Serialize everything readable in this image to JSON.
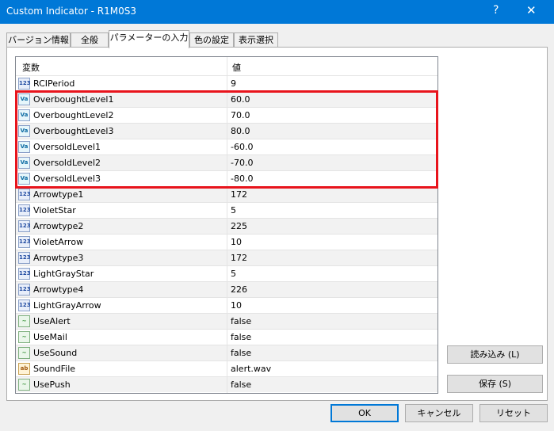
{
  "window": {
    "title": "Custom Indicator - R1M0S3",
    "help_glyph": "?",
    "close_glyph": "✕"
  },
  "tabs": [
    "バージョン情報",
    "全般",
    "パラメーターの入力",
    "色の設定",
    "表示選択"
  ],
  "grid": {
    "header": {
      "col1": "変数",
      "col2": "値"
    },
    "rows": [
      {
        "icon": "int-icon",
        "name": "RCIPeriod",
        "value": "9"
      },
      {
        "icon": "double-icon",
        "name": "OverboughtLevel1",
        "value": "60.0"
      },
      {
        "icon": "double-icon",
        "name": "OverboughtLevel2",
        "value": "70.0"
      },
      {
        "icon": "double-icon",
        "name": "OverboughtLevel3",
        "value": "80.0"
      },
      {
        "icon": "double-icon",
        "name": "OversoldLevel1",
        "value": "-60.0"
      },
      {
        "icon": "double-icon",
        "name": "OversoldLevel2",
        "value": "-70.0"
      },
      {
        "icon": "double-icon",
        "name": "OversoldLevel3",
        "value": "-80.0"
      },
      {
        "icon": "int-icon",
        "name": "Arrowtype1",
        "value": "172"
      },
      {
        "icon": "int-icon",
        "name": "VioletStar",
        "value": "5"
      },
      {
        "icon": "int-icon",
        "name": "Arrowtype2",
        "value": "225"
      },
      {
        "icon": "int-icon",
        "name": "VioletArrow",
        "value": "10"
      },
      {
        "icon": "int-icon",
        "name": "Arrowtype3",
        "value": "172"
      },
      {
        "icon": "int-icon",
        "name": "LightGrayStar",
        "value": "5"
      },
      {
        "icon": "int-icon",
        "name": "Arrowtype4",
        "value": "226"
      },
      {
        "icon": "int-icon",
        "name": "LightGrayArrow",
        "value": "10"
      },
      {
        "icon": "bool-icon",
        "name": "UseAlert",
        "value": "false"
      },
      {
        "icon": "bool-icon",
        "name": "UseMail",
        "value": "false"
      },
      {
        "icon": "bool-icon",
        "name": "UseSound",
        "value": "false"
      },
      {
        "icon": "string-icon",
        "name": "SoundFile",
        "value": "alert.wav"
      },
      {
        "icon": "bool-icon",
        "name": "UsePush",
        "value": "false"
      }
    ]
  },
  "icon_labels": {
    "int-icon": "123",
    "double-icon": "Va",
    "bool-icon": "~",
    "string-icon": "ab"
  },
  "side_buttons": {
    "load": "読み込み (L)",
    "save": "保存 (S)"
  },
  "footer_buttons": {
    "ok": "OK",
    "cancel": "キャンセル",
    "reset": "リセット"
  },
  "colors": {
    "titlebar": "#0078d7",
    "highlight": "#e8141c"
  }
}
